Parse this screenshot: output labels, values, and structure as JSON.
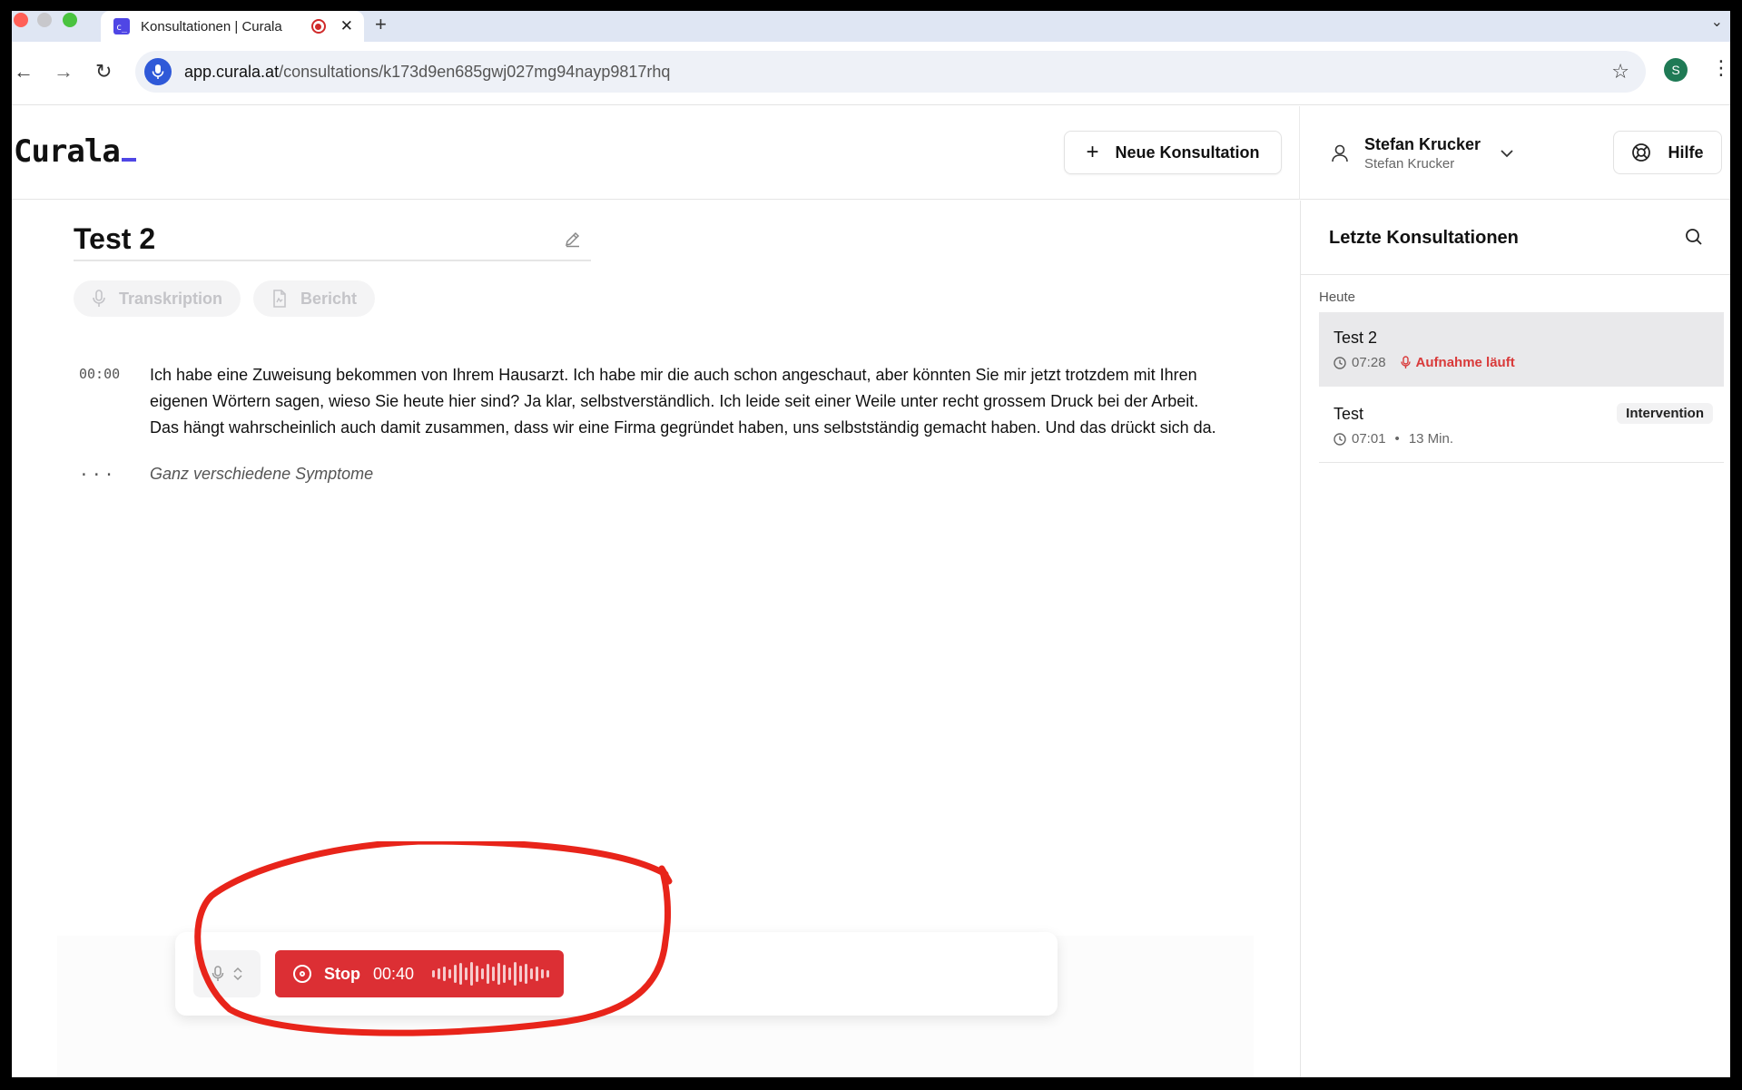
{
  "browser": {
    "tab_title": "Konsultationen | Curala",
    "favicon_text": "c_",
    "url_host": "app.curala.at",
    "url_path": "/consultations/k173d9en685gwj027mg94nayp9817rhq",
    "profile_initial": "S"
  },
  "header": {
    "logo": "Curala",
    "new_consultation_label": "Neue Konsultation",
    "user_name": "Stefan Krucker",
    "user_sub": "Stefan Krucker",
    "help_label": "Hilfe"
  },
  "consultation": {
    "title": "Test 2",
    "tabs": [
      {
        "label": "Transkription",
        "icon": "mic-icon"
      },
      {
        "label": "Bericht",
        "icon": "document-icon"
      }
    ],
    "transcript": [
      {
        "time": "00:00",
        "text": "Ich habe eine Zuweisung bekommen von Ihrem Hausarzt. Ich habe mir die auch schon angeschaut, aber könnten Sie mir jetzt trotzdem mit Ihren eigenen Wörtern sagen, wieso Sie heute hier sind? Ja klar, selbstverständlich. Ich leide seit einer Weile unter recht grossem Druck bei der Arbeit. Das hängt wahrscheinlich auch damit zusammen, dass wir eine Firma gegründet haben, uns selbstständig gemacht haben. Und das drückt sich da."
      },
      {
        "time": "...",
        "text": "Ganz verschiedene Symptome"
      }
    ]
  },
  "recorder": {
    "stop_label": "Stop",
    "timer": "00:40"
  },
  "sidebar": {
    "title": "Letzte Konsultationen",
    "group_label": "Heute",
    "items": [
      {
        "title": "Test 2",
        "time": "07:28",
        "status": "Aufnahme läuft"
      },
      {
        "title": "Test",
        "time": "07:01",
        "duration": "13 Min.",
        "tag": "Intervention"
      }
    ]
  },
  "colors": {
    "accent": "#4f46e5",
    "record_red": "#dc2f34",
    "annotation_red": "#e8241a"
  }
}
